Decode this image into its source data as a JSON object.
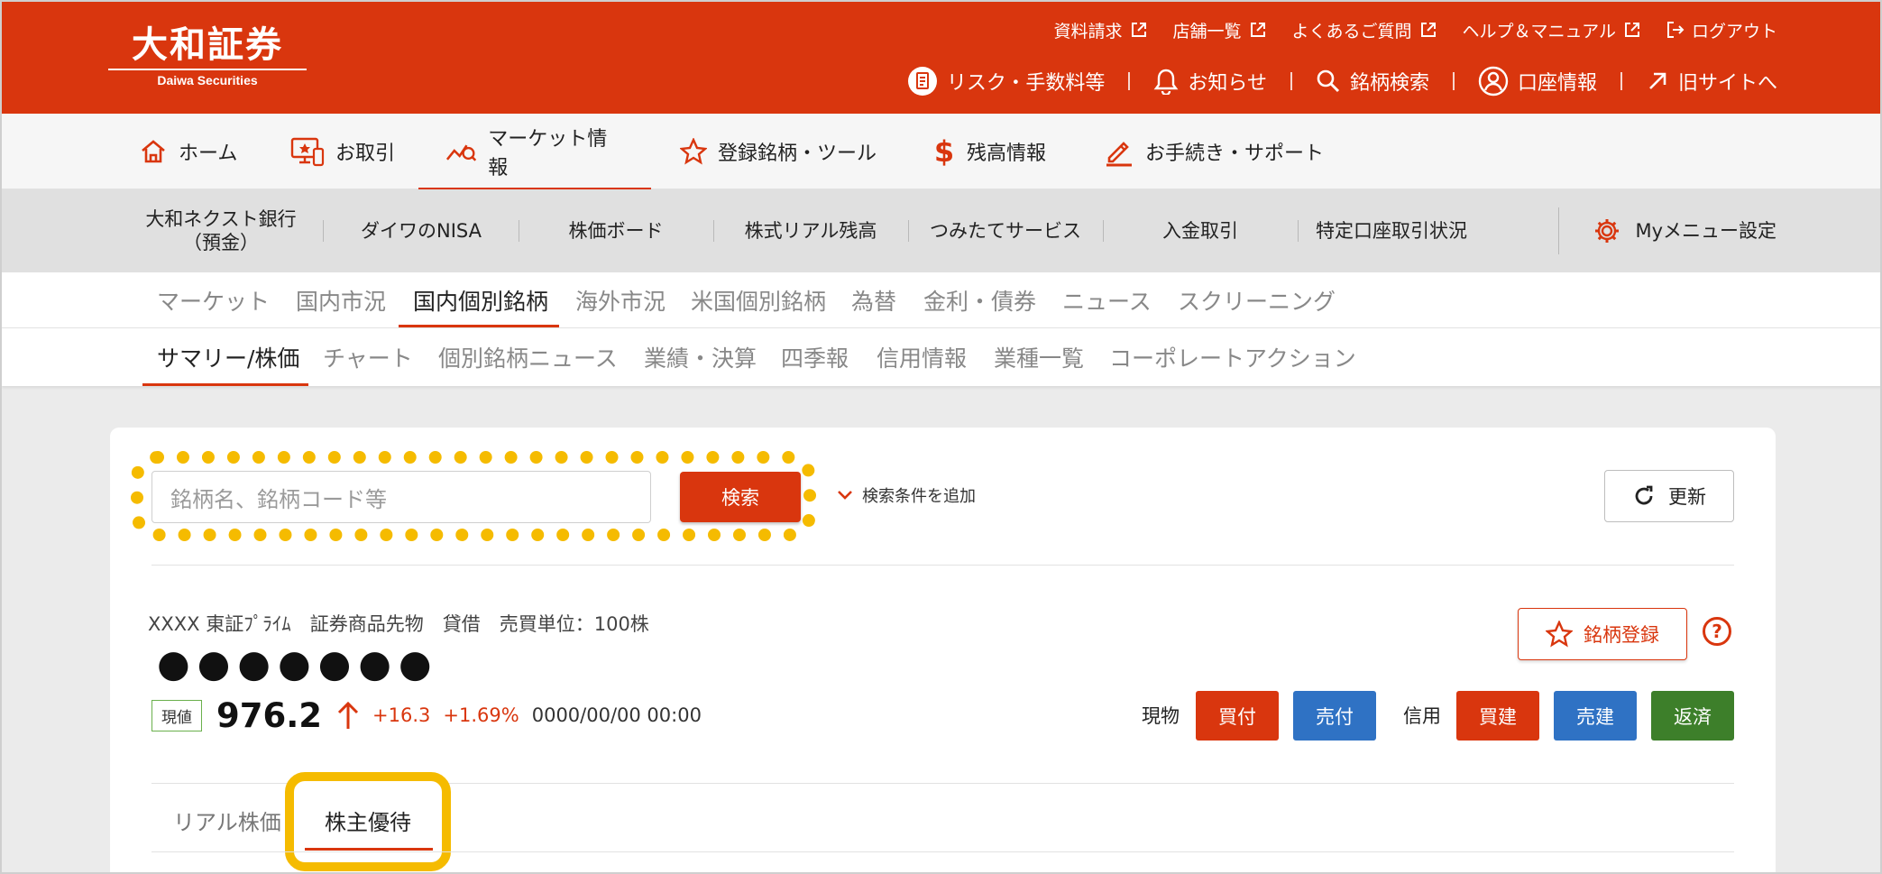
{
  "header": {
    "logo_jp": "大和証券",
    "logo_en": "Daiwa Securities",
    "top_links": [
      {
        "label": "資料請求"
      },
      {
        "label": "店舗一覧"
      },
      {
        "label": "よくあるご質問"
      },
      {
        "label": "ヘルプ＆マニュアル"
      },
      {
        "label": "ログアウト"
      }
    ],
    "utility_links": [
      {
        "label": "リスク・手数料等",
        "icon": "document-icon"
      },
      {
        "label": "お知らせ",
        "icon": "bell-icon"
      },
      {
        "label": "銘柄検索",
        "icon": "search-icon"
      },
      {
        "label": "口座情報",
        "icon": "user-icon"
      },
      {
        "label": "旧サイトへ",
        "icon": "arrow-up-right-icon"
      }
    ]
  },
  "global_nav": [
    {
      "label": "ホーム",
      "icon": "home-icon"
    },
    {
      "label": "お取引",
      "icon": "trade-monitor-icon"
    },
    {
      "label": "マーケット情報",
      "icon": "market-chart-icon",
      "active": true
    },
    {
      "label": "登録銘柄・ツール",
      "icon": "star-icon"
    },
    {
      "label": "残高情報",
      "icon": "dollar-icon"
    },
    {
      "label": "お手続き・サポート",
      "icon": "pencil-icon"
    }
  ],
  "quick_menu": {
    "items": [
      {
        "label": "大和ネクスト銀行",
        "sub": "（預金）"
      },
      {
        "label": "ダイワのNISA"
      },
      {
        "label": "株価ボード"
      },
      {
        "label": "株式リアル残高"
      },
      {
        "label": "つみたてサービス"
      },
      {
        "label": "入金取引"
      },
      {
        "label": "特定口座取引状況"
      }
    ],
    "settings_label": "Myメニュー設定"
  },
  "market_tabs": [
    "マーケット",
    "国内市況",
    "国内個別銘柄",
    "海外市況",
    "米国個別銘柄",
    "為替",
    "金利・債券",
    "ニュース",
    "スクリーニング"
  ],
  "market_tab_active": "国内個別銘柄",
  "stock_tabs": [
    "サマリー/株価",
    "チャート",
    "個別銘柄ニュース",
    "業績・決算",
    "四季報",
    "信用情報",
    "業種一覧",
    "コーポレートアクション"
  ],
  "stock_tab_active": "サマリー/株価",
  "search": {
    "placeholder": "銘柄名、銘柄コード等",
    "button": "検索",
    "add_condition": "検索条件を追加",
    "refresh": "更新"
  },
  "stock": {
    "meta": "XXXX 東証ﾌﾟﾗｲﾑ　証券商品先物　貸借　売買単位：100株",
    "name": "●●●●●●●",
    "price_badge": "現値",
    "price": "976.2",
    "change": "+16.3",
    "change_pct": "+1.69%",
    "timestamp": "0000/00/00 00:00",
    "register": "銘柄登録",
    "help": "?"
  },
  "trade": {
    "cash_label": "現物",
    "buy": "買付",
    "sell": "売付",
    "margin_label": "信用",
    "margin_buy": "買建",
    "margin_sell": "売建",
    "repay": "返済"
  },
  "bottom_tabs": [
    "リアル株価",
    "株主優待"
  ],
  "colors": {
    "brand": "#d9360e",
    "buy": "#d9360e",
    "sell": "#2f72c4",
    "repay": "#3d7f2a",
    "highlight": "#f5bb00"
  }
}
